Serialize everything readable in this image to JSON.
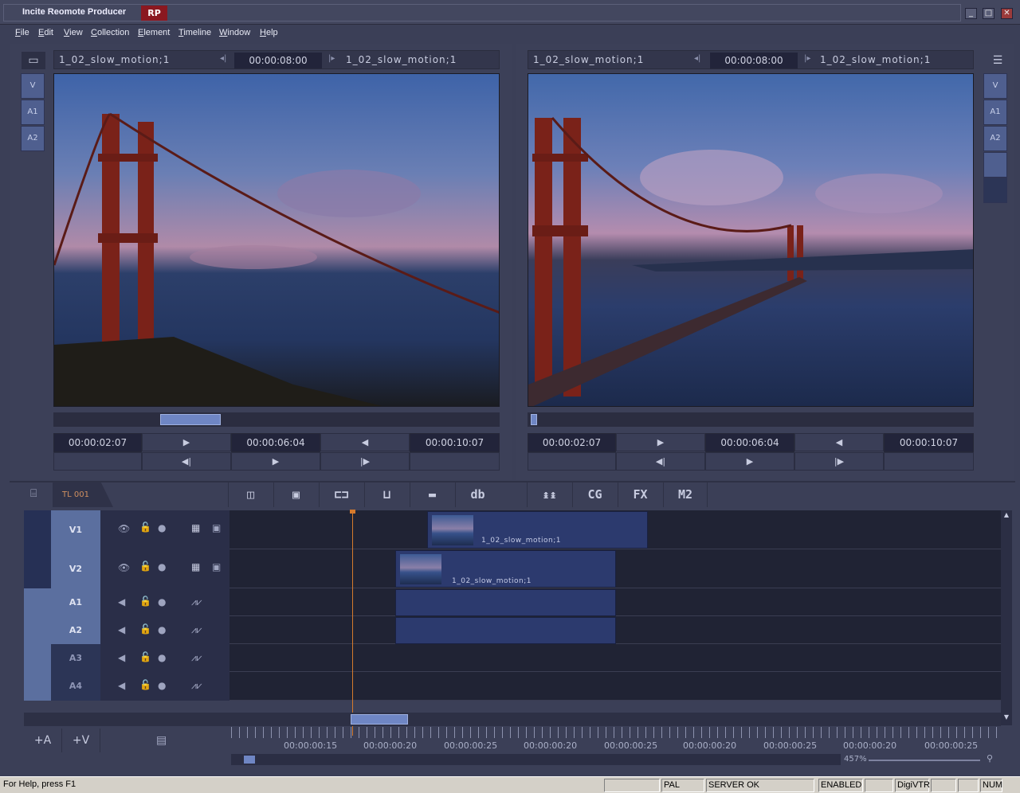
{
  "app": {
    "title": "Incite Reomote Producer",
    "badge": "RP"
  },
  "menu": [
    "File",
    "Edit",
    "View",
    "Collection",
    "Element",
    "Timeline",
    "Window",
    "Help"
  ],
  "source_monitor": {
    "clip_name": "1_02_slow_motion;1",
    "duration": "00:00:08:00",
    "linked_clip": "1_02_slow_motion;1",
    "tracks": [
      "V",
      "A1",
      "A2"
    ],
    "in_tc": "00:00:02:07",
    "current_tc": "00:00:06:04",
    "out_tc": "00:00:10:07"
  },
  "program_monitor": {
    "clip_name": "1_02_slow_motion;1",
    "duration": "00:00:08:00",
    "linked_clip": "1_02_slow_motion;1",
    "tracks": [
      "V",
      "A1",
      "A2"
    ],
    "in_tc": "00:00:02:07",
    "current_tc": "00:00:06:04",
    "out_tc": "00:00:10:07"
  },
  "timeline": {
    "tab": "TL 001",
    "tools": [
      "◫",
      "▣",
      "⊏⊐",
      "⊔",
      "▬",
      "db",
      "↨↨",
      "CG",
      "FX",
      "M2"
    ],
    "tracks": [
      "V1",
      "V2",
      "A1",
      "A2",
      "A3",
      "A4"
    ],
    "clips": [
      {
        "track": "V1",
        "label": "1_02_slow_motion;1"
      },
      {
        "track": "V2",
        "label": "1_02_slow_motion;1"
      }
    ],
    "add_audio": "+A",
    "add_video": "+V",
    "ruler": [
      "00:00:00:15",
      "00:00:00:20",
      "00:00:00:25",
      "00:00:00:20",
      "00:00:00:25",
      "00:00:00:20",
      "00:00:00:25",
      "00:00:00:20",
      "00:00:00:25"
    ],
    "zoom": "457%"
  },
  "status": {
    "help": "For Help, press F1",
    "format": "PAL",
    "server": "SERVER OK",
    "enabled": "ENABLED",
    "device": "DigiVTR",
    "num": "NUM"
  }
}
